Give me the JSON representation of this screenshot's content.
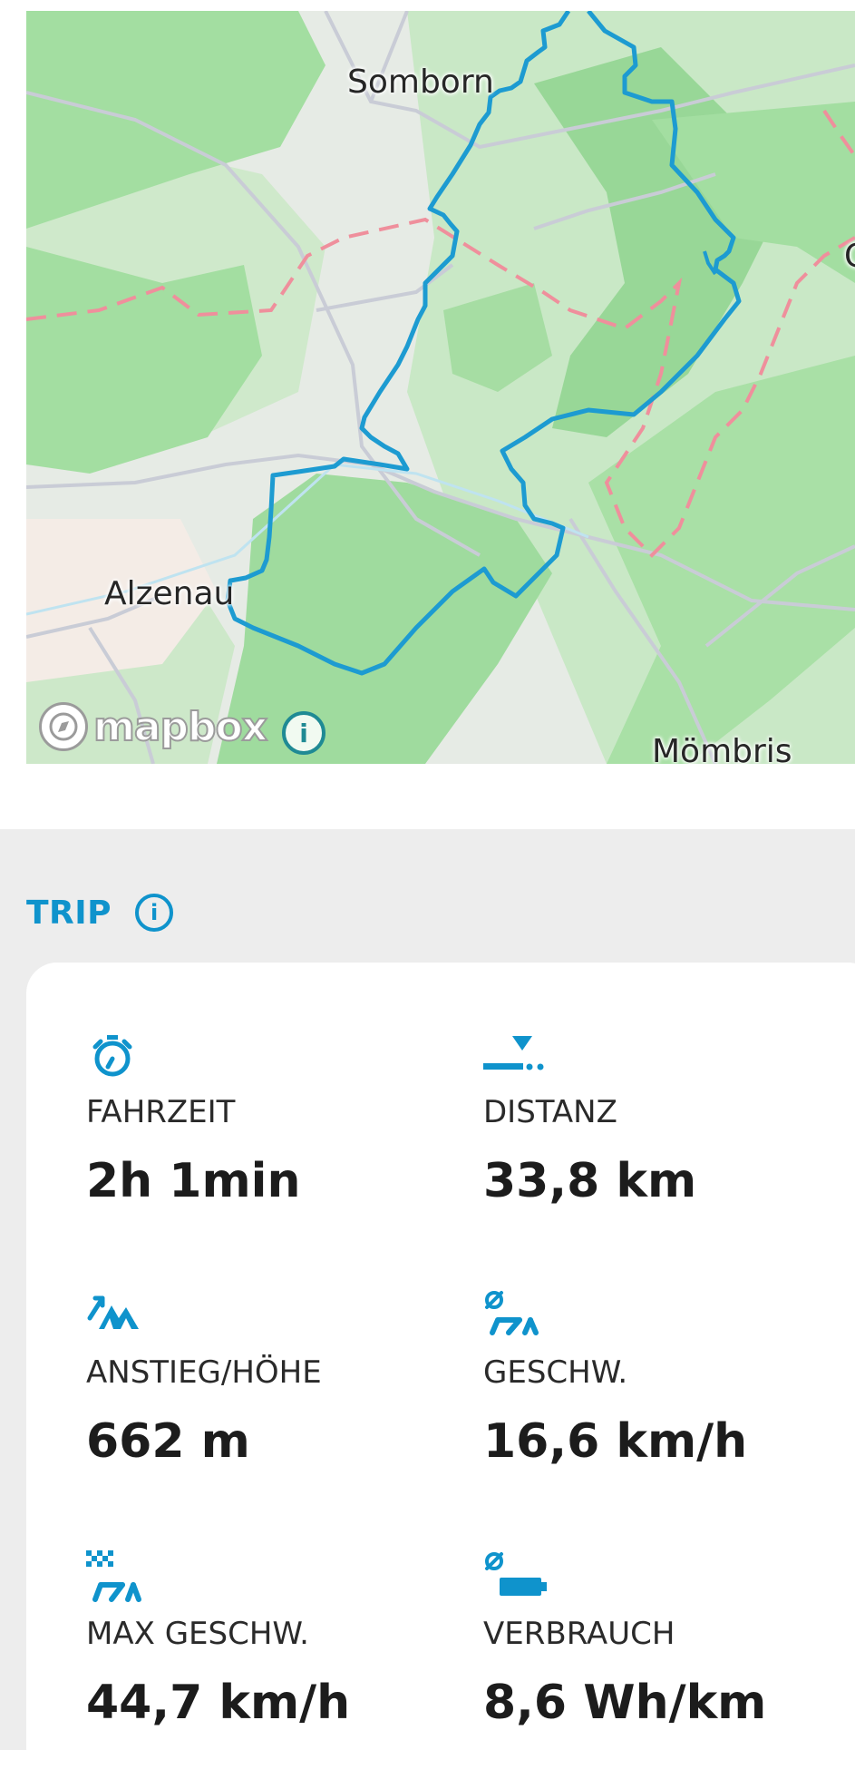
{
  "map": {
    "places": {
      "somborn": "Somborn",
      "alzenau": "Alzenau",
      "mombris": "Mömbris",
      "edge_label": "G"
    },
    "attribution": {
      "logo_text": "mapbox",
      "info_glyph": "i"
    },
    "colors": {
      "route": "#1d9bd1",
      "forest": "#a3dea1",
      "border": "#ef8f9c",
      "road": "#c9ccd6"
    }
  },
  "trip": {
    "title": "TRIP",
    "info_glyph": "i",
    "accent": "#0f93cc",
    "stats": {
      "ride_time": {
        "icon": "stopwatch-icon",
        "label": "FAHRZEIT",
        "value": "2h 1min"
      },
      "distance": {
        "icon": "distance-icon",
        "label": "DISTANZ",
        "value": "33,8 km"
      },
      "elevation": {
        "icon": "elevation-icon",
        "label": "ANSTIEG/HÖHE",
        "value": "662 m"
      },
      "avg_speed": {
        "icon": "avg-speed-icon",
        "label": "GESCHW.",
        "value": "16,6 km/h"
      },
      "max_speed": {
        "icon": "max-speed-icon",
        "label": "MAX GESCHW.",
        "value": "44,7 km/h"
      },
      "consumption": {
        "icon": "battery-consumption-icon",
        "label": "VERBRAUCH",
        "value": "8,6 Wh/km"
      }
    }
  }
}
